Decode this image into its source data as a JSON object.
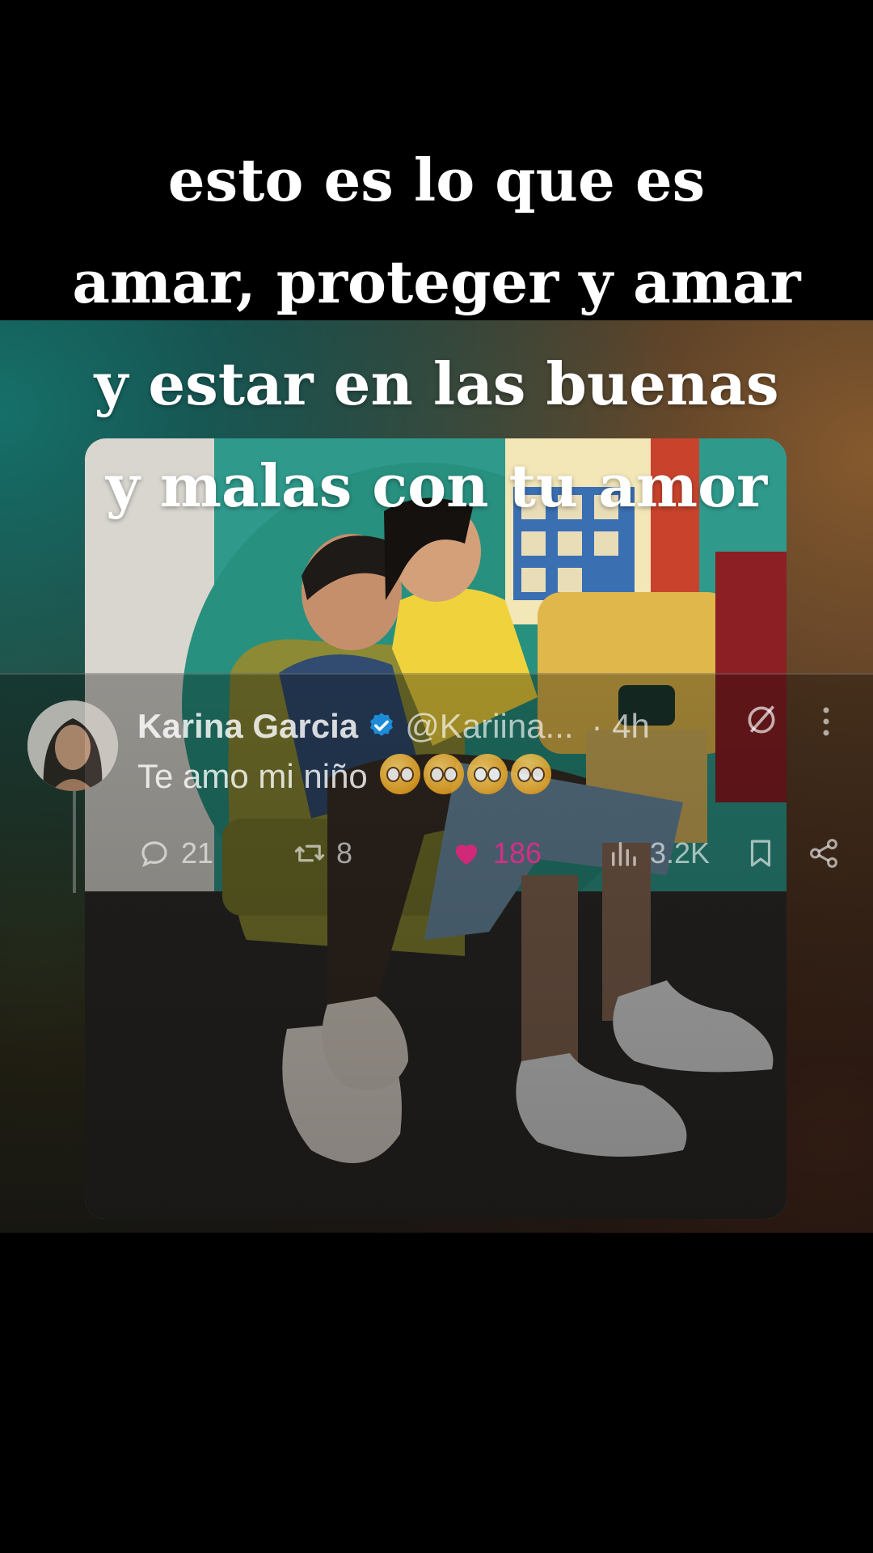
{
  "caption": {
    "lines": [
      "esto es lo que es",
      "amar, proteger y amar",
      "y estar en las buenas",
      "y malas con tu amor"
    ]
  },
  "tweet": {
    "author_name": "Karina Garcia",
    "handle": "@Kariina...",
    "time": "· 4h",
    "text": "Te amo mi niño",
    "emoji_count": 4,
    "verified": true,
    "icons": {
      "verified": "verified-badge-icon",
      "grok": "grok-icon",
      "more": "more-vertical-icon"
    },
    "actions": {
      "replies": "21",
      "retweets": "8",
      "likes": "186",
      "views": "3.2K"
    },
    "action_icons": [
      "reply-icon",
      "retweet-icon",
      "heart-icon",
      "views-icon",
      "bookmark-icon",
      "share-icon"
    ]
  },
  "colors": {
    "like": "#e0247c",
    "verified": "#1d9bf0"
  }
}
